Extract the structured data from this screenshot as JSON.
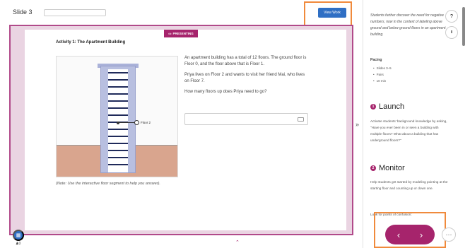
{
  "topbar": {
    "slide_label": "Slide 3",
    "view_work_label": "View Work"
  },
  "slide": {
    "presenting_label": "PRESENTING",
    "activity_title": "Activity 1: The Apartment Building",
    "floor_marker_label": "Floor 2",
    "note": "(Note: Use the interactive floor segment to help you answer).",
    "problem": [
      "An apartment building has a total of 12 floors. The ground floor is Floor 0, and the floor above that is Floor 1.",
      "Priya lives on Floor 2 and wants to visit her friend Mai, who lives on Floor 7.",
      "How many floors up does Priya need to go?"
    ]
  },
  "panel": {
    "intro": "Students further discover the need for negative numbers, now in the context of labeling above ground and below ground floors in an apartment building.",
    "pacing_title": "Pacing",
    "pacing_items": [
      "Slides 3–5",
      "Pairs",
      "10 min"
    ],
    "launch_num": "1",
    "launch_title": "Launch",
    "launch_text": "Activate students' background knowledge by asking, \"Have you ever been in or seen a building with multiple floors? What about a building that has underground floors?\"",
    "monitor_num": "2",
    "monitor_title": "Monitor",
    "monitor_text": "Help students get started by modeling pointing at the starting floor and counting up or down one.",
    "confusion_text": "Look for points of confusion:"
  },
  "controls": {
    "help_label": "?",
    "pause_label": "II",
    "prev_icon": "‹",
    "next_icon": "›",
    "more_label": "···",
    "expand_icon": "»",
    "user_count": "0"
  },
  "colors": {
    "accent": "#a6246c",
    "primary": "#2f6fc4",
    "highlight": "#f08a3c"
  }
}
